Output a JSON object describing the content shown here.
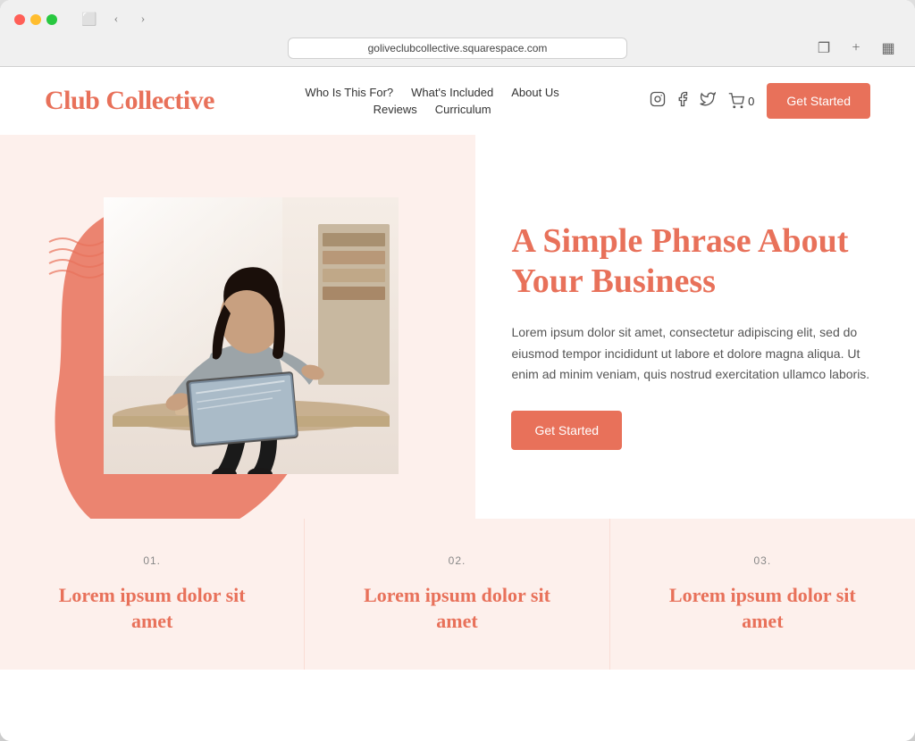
{
  "browser": {
    "url": "goliveclubcollective.squarespace.com",
    "window_controls": {
      "red": "close",
      "yellow": "minimize",
      "green": "maximize"
    }
  },
  "header": {
    "logo": "Club Collective",
    "nav": {
      "row1": [
        {
          "label": "Who Is This For?",
          "id": "who-is-this-for"
        },
        {
          "label": "What's Included",
          "id": "whats-included"
        },
        {
          "label": "About Us",
          "id": "about-us"
        }
      ],
      "row2": [
        {
          "label": "Reviews",
          "id": "reviews"
        },
        {
          "label": "Curriculum",
          "id": "curriculum"
        }
      ]
    },
    "social": {
      "instagram": "Instagram",
      "facebook": "Facebook",
      "twitter": "Twitter"
    },
    "cart_label": "0",
    "cta_button": "Get Started"
  },
  "hero": {
    "headline": "A Simple Phrase About Your Business",
    "body": "Lorem ipsum dolor sit amet, consectetur adipiscing elit, sed do eiusmod tempor incididunt ut labore et dolore magna aliqua. Ut enim ad minim veniam, quis nostrud exercitation ullamco laboris.",
    "cta_button": "Get Started"
  },
  "features": [
    {
      "number": "01.",
      "title": "Lorem ipsum dolor sit amet"
    },
    {
      "number": "02.",
      "title": "Lorem ipsum dolor sit amet"
    },
    {
      "number": "03.",
      "title": "Lorem ipsum dolor sit amet"
    }
  ],
  "colors": {
    "brand_orange": "#e8715a",
    "bg_peach": "#fdf0ec",
    "text_dark": "#333333",
    "text_muted": "#555555"
  }
}
